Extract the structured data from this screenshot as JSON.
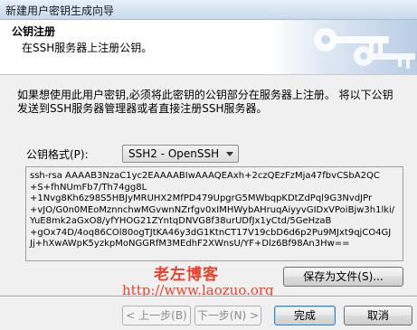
{
  "window": {
    "title": "新建用户密钥生成向导"
  },
  "header": {
    "title": "公钥注册",
    "subtitle": "在SSH服务器上注册公钥。",
    "graphic_icon": "keys-icon"
  },
  "description": {
    "line1": "如果想使用此用户密钥,必须将此密钥的公钥部分在服务器上注册。 将以下公钥",
    "line2": "发送到SSH服务器管理器或者直接注册SSH服务器。"
  },
  "format": {
    "label": "公钥格式(P):",
    "selected": "SSH2 - OpenSSH"
  },
  "public_key": {
    "lines": [
      "ssh-rsa AAAAB3NzaC1yc2EAAAABIwAAAQEAxh+2czQEzFzMja47fbvCSbA2QC",
      "+S+fhNUmFb7/Th74gg8L",
      "+1Nvg8Kh6z98S5HBJyMRUHX2MfPD479UpgrG5MWbqpKDtZdPql9G3NvdJPr",
      "+vJO/G0n0MEoMznnchwMGvwnNZrfgv0xIMHWybAHruqAiyyvGIDxVPoiBjw3h1lki/",
      "YuE8mk2aGxO8/yfYHOG21ZYntqDNVG8f38urUDfJx1yCtd/5GeHzaB",
      "+gOx74D/4oq86COl80ogTJtKA46y3dG1KtnCT17V19cbD6d6p2Pu9MJxt9qjCO4GJ",
      "Jj+hXwAWpK5yzkpMoNGGRfM3MEdhF2XWnsU/YF+Dlz6Bf98An3Hw=="
    ]
  },
  "buttons": {
    "save": "保存为文件(S)...",
    "back": "< 上一步(B)",
    "next": "下一步(N) >",
    "finish": "完成",
    "cancel": "取消"
  },
  "watermark": {
    "name": "老左博客",
    "url": "http://www.laozuo.org"
  },
  "colors": {
    "watermark": "#e8422b",
    "default_button_border": "#3c7fb1"
  }
}
